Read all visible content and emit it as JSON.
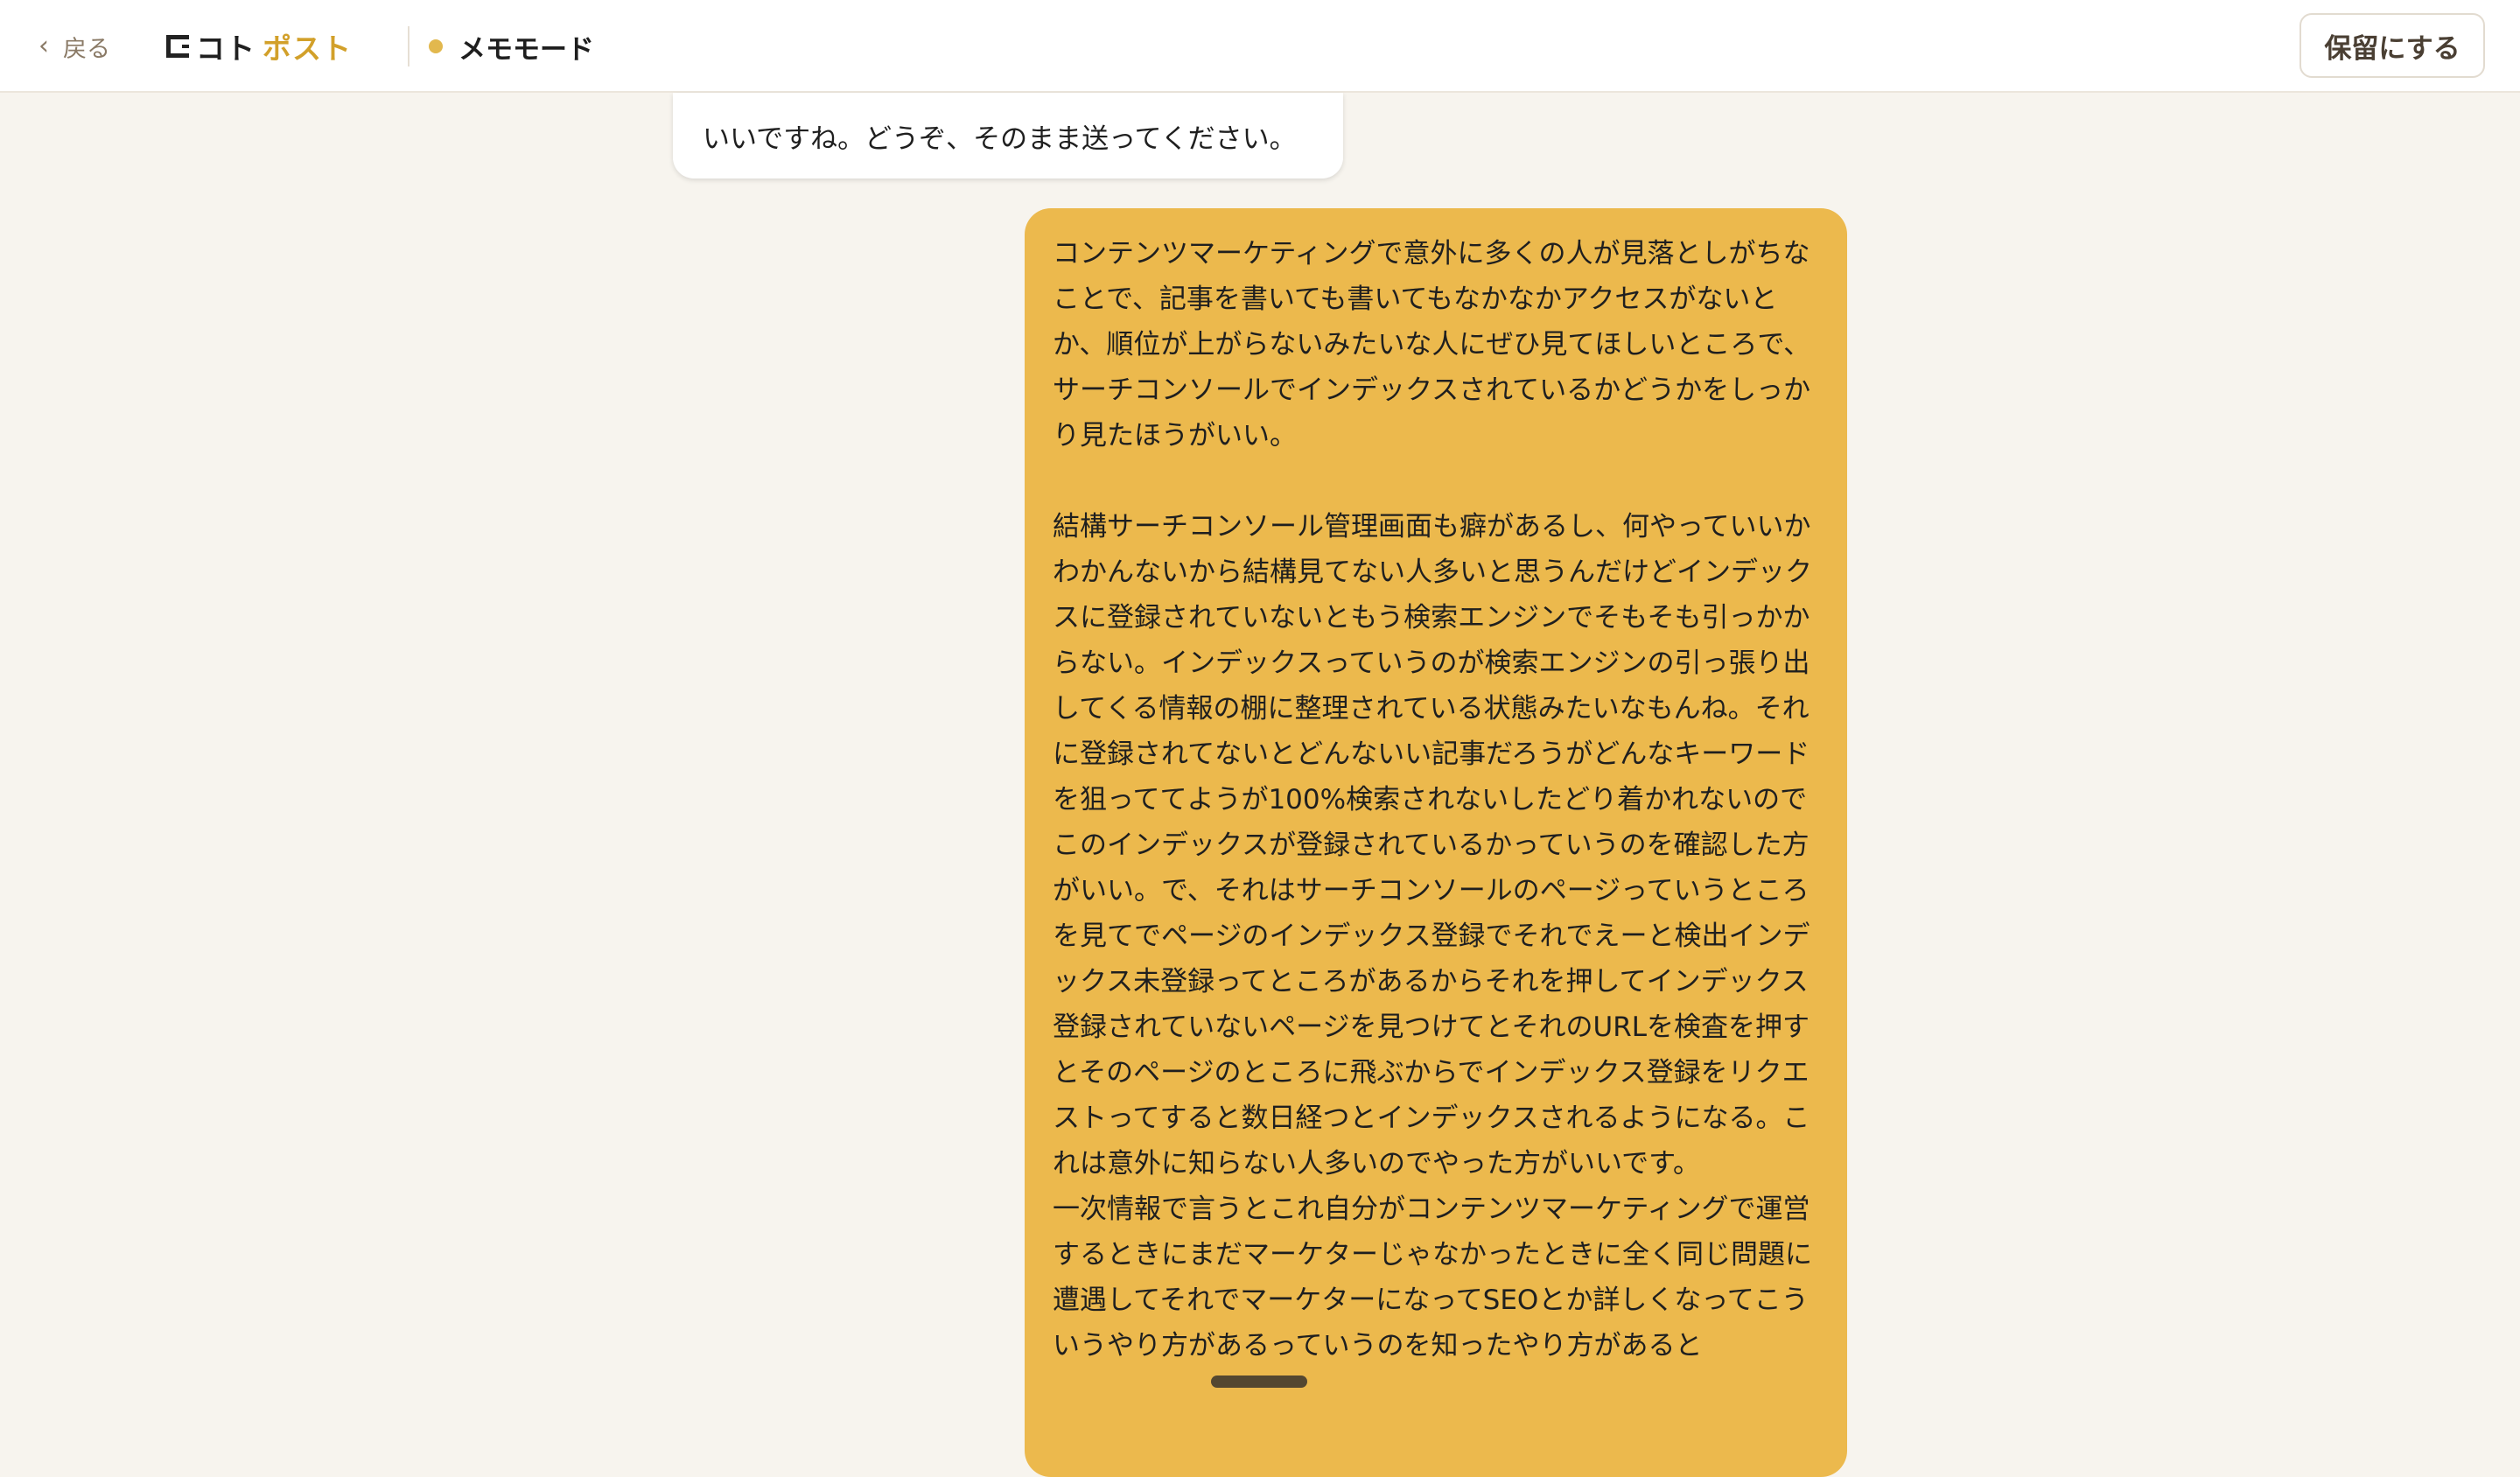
{
  "header": {
    "back_label": "戻る",
    "logo_text_dark": "コト",
    "logo_text_accent": "ポスト",
    "mode_label": "メモモード",
    "hold_button_label": "保留にする"
  },
  "colors": {
    "accent": "#ecb94d",
    "logo_accent": "#d2a02a",
    "background": "#f7f4ee"
  },
  "messages": {
    "ai": "いいですね。どうぞ、そのまま送ってください。",
    "user": "コンテンツマーケティングで意外に多くの人が見落としがちなことで、記事を書いても書いてもなかなかアクセスがないとか、順位が上がらないみたいな人にぜひ見てほしいところで、サーチコンソールでインデックスされているかどうかをしっかり見たほうがいい。\n\n結構サーチコンソール管理画面も癖があるし、何やっていいかわかんないから結構見てない人多いと思うんだけどインデックスに登録されていないともう検索エンジンでそもそも引っかからない。インデックスっていうのが検索エンジンの引っ張り出してくる情報の棚に整理されている状態みたいなもんね。それに登録されてないとどんないい記事だろうがどんなキーワードを狙っててようが100%検索されないしたどり着かれないのでこのインデックスが登録されているかっていうのを確認した方がいい。で、それはサーチコンソールのページっていうところを見てでページのインデックス登録でそれでえーと検出インデックス未登録ってところがあるからそれを押してインデックス登録されていないページを見つけてとそれのURLを検査を押すとそのページのところに飛ぶからでインデックス登録をリクエストってすると数日経つとインデックスされるようになる。これは意外に知らない人多いのでやった方がいいです。\n一次情報で言うとこれ自分がコンテンツマーケティングで運営するときにまだマーケターじゃなかったときに全く同じ問題に遭遇してそれでマーケターになってSEOとか詳しくなってこういうやり方があるっていうのを知ったやり方があると"
  }
}
